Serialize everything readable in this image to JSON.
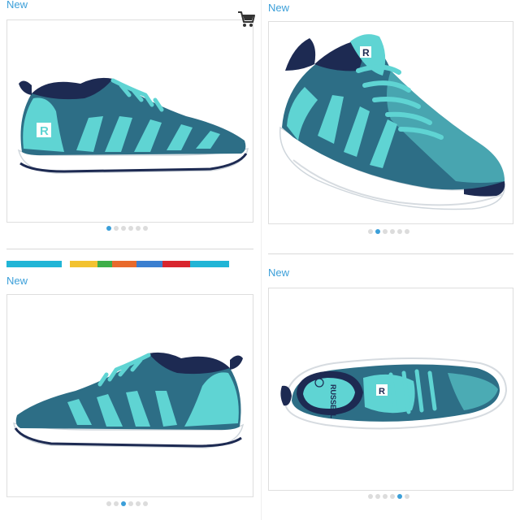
{
  "colors": {
    "accent": "#3b9fd9",
    "shoe_knit": "#2d6e86",
    "shoe_aqua": "#5fd4d3",
    "shoe_navy": "#1d2a52",
    "sole": "#ffffff"
  },
  "products": [
    {
      "badge": "New",
      "view": "side-right",
      "dots_total": 6,
      "active_dot": 0
    },
    {
      "badge": "New",
      "view": "three-quarter",
      "dots_total": 6,
      "active_dot": 1
    },
    {
      "badge": "New",
      "view": "side-left",
      "dots_total": 6,
      "active_dot": 2
    },
    {
      "badge": "New",
      "view": "top-down",
      "dots_total": 6,
      "active_dot": 4
    }
  ],
  "cart_icon": "shopping-cart-icon",
  "color_strip": [
    "#21b5d6",
    "#21b5d6",
    "#ffffff",
    "#f2c230",
    "#3fae49",
    "#e86a2c",
    "#3b7fd0",
    "#d8252e",
    "#21b5d6"
  ]
}
